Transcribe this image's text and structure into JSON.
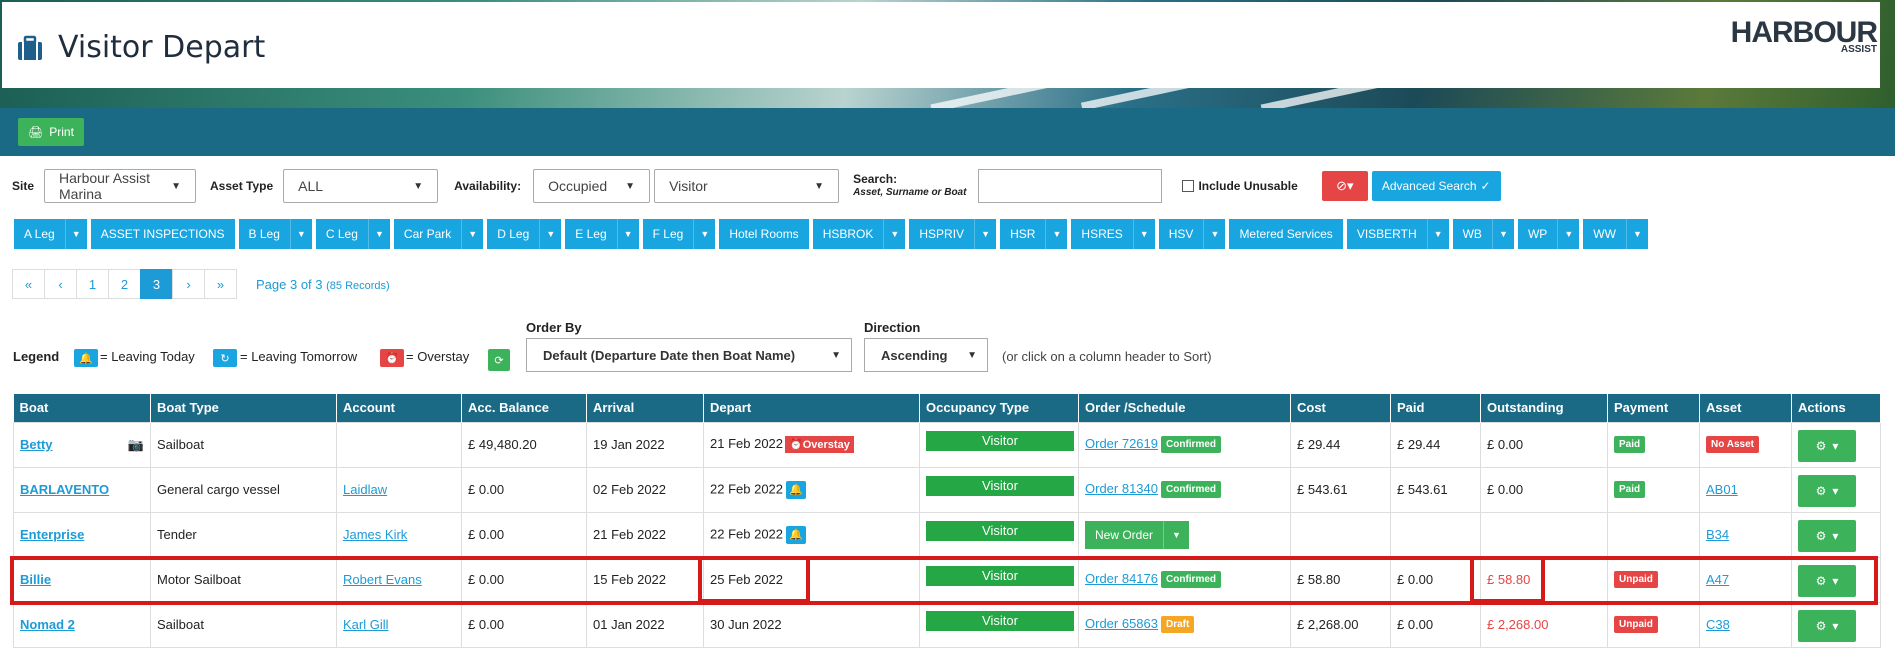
{
  "header": {
    "title": "Visitor Depart",
    "logo_main": "HARBOUR",
    "logo_sub": "ASSIST"
  },
  "toolbar": {
    "print_label": "Print"
  },
  "filters": {
    "site_label": "Site",
    "site_value": "Harbour Assist Marina",
    "asset_type_label": "Asset Type",
    "asset_type_value": "ALL",
    "availability_label": "Availability:",
    "availability_value": "Occupied",
    "visitor_value": "Visitor",
    "search_label": "Search:",
    "search_sub": "Asset, Surname or Boat",
    "search_value": "",
    "include_unusable_label": "Include Unusable",
    "advanced_search_label": "Advanced Search"
  },
  "legs": [
    {
      "label": "A Leg",
      "dropdown": true
    },
    {
      "label": "ASSET INSPECTIONS",
      "dropdown": false
    },
    {
      "label": "B Leg",
      "dropdown": true
    },
    {
      "label": "C Leg",
      "dropdown": true
    },
    {
      "label": "Car Park",
      "dropdown": true
    },
    {
      "label": "D Leg",
      "dropdown": true
    },
    {
      "label": "E Leg",
      "dropdown": true
    },
    {
      "label": "F Leg",
      "dropdown": true
    },
    {
      "label": "Hotel Rooms",
      "dropdown": false
    },
    {
      "label": "HSBROK",
      "dropdown": true
    },
    {
      "label": "HSPRIV",
      "dropdown": true
    },
    {
      "label": "HSR",
      "dropdown": true
    },
    {
      "label": "HSRES",
      "dropdown": true
    },
    {
      "label": "HSV",
      "dropdown": true
    },
    {
      "label": "Metered Services",
      "dropdown": false
    },
    {
      "label": "VISBERTH",
      "dropdown": true
    },
    {
      "label": "WB",
      "dropdown": true
    },
    {
      "label": "WP",
      "dropdown": true
    },
    {
      "label": "WW",
      "dropdown": true
    }
  ],
  "pagination": {
    "buttons": [
      "«",
      "‹",
      "1",
      "2",
      "3",
      "›",
      "»"
    ],
    "active": "3",
    "info": "Page 3 of 3",
    "records": "(85 Records)"
  },
  "legend": {
    "title": "Legend",
    "leaving_today": "= Leaving Today",
    "leaving_tomorrow": "= Leaving Tomorrow",
    "overstay": "= Overstay",
    "order_by_label": "Order By",
    "order_by_value": "Default (Departure Date then Boat Name)",
    "direction_label": "Direction",
    "direction_value": "Ascending",
    "sort_hint": "(or click on a column header to Sort)"
  },
  "table": {
    "headers": [
      "Boat",
      "Boat Type",
      "Account",
      "Acc. Balance",
      "Arrival",
      "Depart",
      "Occupancy Type",
      "Order /Schedule",
      "Cost",
      "Paid",
      "Outstanding",
      "Payment",
      "Asset",
      "Actions"
    ],
    "rows": [
      {
        "boat": "Betty",
        "boat_type": "Sailboat",
        "account": "",
        "balance": "£ 49,480.20",
        "arrival": "19 Jan 2022",
        "depart": "21 Feb 2022",
        "depart_flag": "Overstay",
        "occupancy": "Visitor",
        "order": "Order 72619",
        "order_status": "Confirmed",
        "cost": "£ 29.44",
        "paid": "£ 29.44",
        "outstanding": "£ 0.00",
        "payment": "Paid",
        "asset": "No Asset"
      },
      {
        "boat": "BARLAVENTO",
        "boat_type": "General cargo vessel",
        "account": "Laidlaw",
        "balance": "£ 0.00",
        "arrival": "02 Feb 2022",
        "depart": "22 Feb 2022",
        "depart_flag": "tomorrow",
        "occupancy": "Visitor",
        "order": "Order 81340",
        "order_status": "Confirmed",
        "cost": "£ 543.61",
        "paid": "£ 543.61",
        "outstanding": "£ 0.00",
        "payment": "Paid",
        "asset": "AB01"
      },
      {
        "boat": "Enterprise",
        "boat_type": "Tender",
        "account": "James Kirk",
        "balance": "£ 0.00",
        "arrival": "21 Feb 2022",
        "depart": "22 Feb 2022",
        "depart_flag": "tomorrow",
        "occupancy": "Visitor",
        "order": "New Order",
        "order_status": "",
        "cost": "",
        "paid": "",
        "outstanding": "",
        "payment": "",
        "asset": "B34"
      },
      {
        "boat": "Billie",
        "boat_type": "Motor Sailboat",
        "account": "Robert Evans",
        "balance": "£ 0.00",
        "arrival": "15 Feb 2022",
        "depart": "25 Feb 2022",
        "depart_flag": "",
        "occupancy": "Visitor",
        "order": "Order 84176",
        "order_status": "Confirmed",
        "cost": "£ 58.80",
        "paid": "£ 0.00",
        "outstanding": "£ 58.80",
        "payment": "Unpaid",
        "asset": "A47"
      },
      {
        "boat": "Nomad 2",
        "boat_type": "Sailboat",
        "account": "Karl Gill",
        "balance": "£ 0.00",
        "arrival": "01 Jan 2022",
        "depart": "30 Jun 2022",
        "depart_flag": "",
        "occupancy": "Visitor",
        "order": "Order 65863",
        "order_status": "Draft",
        "cost": "£ 2,268.00",
        "paid": "£ 0.00",
        "outstanding": "£ 2,268.00",
        "payment": "Unpaid",
        "asset": "C38"
      }
    ]
  },
  "colors": {
    "accent": "#18a5e0",
    "header_bar": "#1a6a85",
    "success": "#3cb35a",
    "danger": "#e64545",
    "warning": "#f5a623"
  }
}
